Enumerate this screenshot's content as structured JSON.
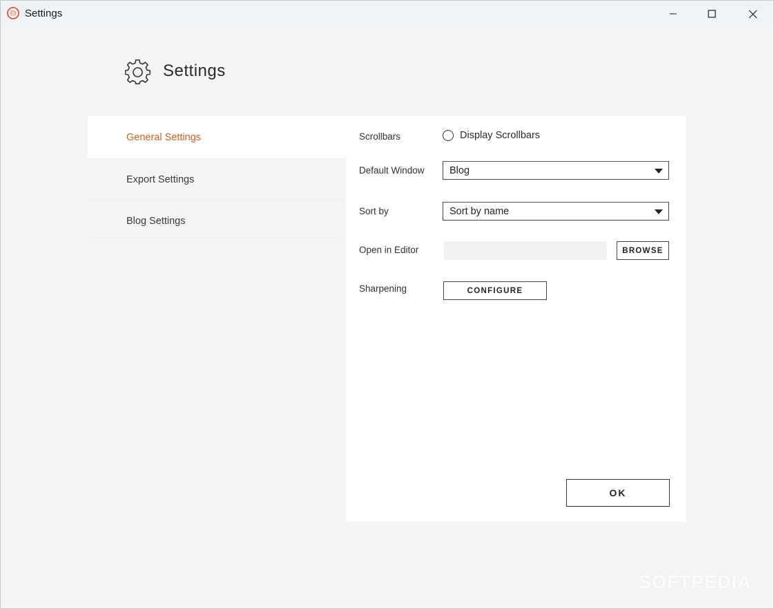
{
  "window": {
    "title": "Settings"
  },
  "header": {
    "title": "Settings",
    "icon": "gear-icon"
  },
  "nav": {
    "items": [
      {
        "label": "General Settings",
        "active": true
      },
      {
        "label": "Export Settings",
        "active": false
      },
      {
        "label": "Blog Settings",
        "active": false
      }
    ]
  },
  "general": {
    "scrollbars_label": "Scrollbars",
    "display_scrollbars_label": "Display Scrollbars",
    "display_scrollbars_checked": false,
    "default_window_label": "Default Window",
    "default_window_value": "Blog",
    "sort_by_label": "Sort by",
    "sort_by_value": "Sort by name",
    "open_in_editor_label": "Open in Editor",
    "open_in_editor_value": "",
    "browse_label": "BROWSE",
    "sharpening_label": "Sharpening",
    "configure_label": "CONFIGURE"
  },
  "footer": {
    "ok_label": "OK"
  },
  "watermark": "SOFTPEDIA",
  "colors": {
    "accent": "#d2621e",
    "panel": "#ffffff",
    "background": "#f4f4f4",
    "titlebar": "#eff2f7"
  }
}
